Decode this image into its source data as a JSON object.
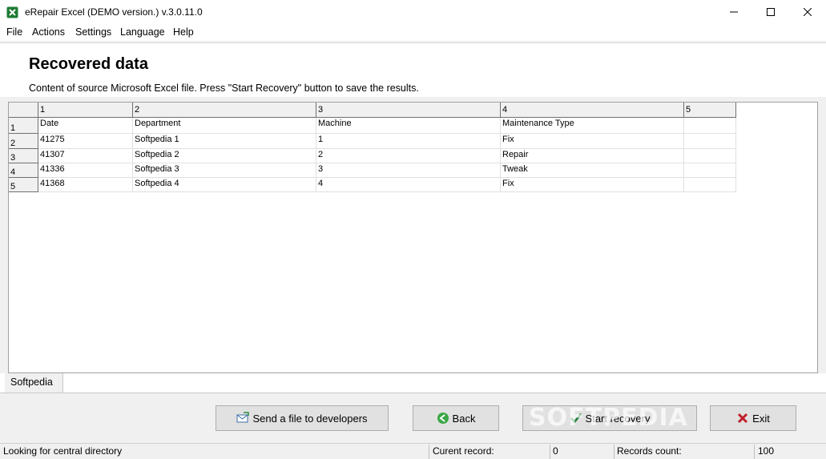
{
  "window": {
    "title": "eRepair Excel (DEMO version.) v.3.0.11.0"
  },
  "menu": [
    "File",
    "Actions",
    "Settings",
    "Language",
    "Help"
  ],
  "header": {
    "title": "Recovered data",
    "description": "Content of source Microsoft Excel file. Press \"Start Recovery\" button to save the results."
  },
  "grid": {
    "column_headers": [
      "1",
      "2",
      "3",
      "4",
      "5"
    ],
    "row_headers": [
      "1",
      "2",
      "3",
      "4",
      "5"
    ],
    "rows": [
      [
        "Date",
        "Department",
        "Machine",
        "Maintenance Type",
        ""
      ],
      [
        "41275",
        "Softpedia 1",
        "1",
        "Fix",
        ""
      ],
      [
        "41307",
        "Softpedia 2",
        "2",
        "Repair",
        ""
      ],
      [
        "41336",
        "Softpedia 3",
        "3",
        "Tweak",
        ""
      ],
      [
        "41368",
        "Softpedia 4",
        "4",
        "Fix",
        ""
      ]
    ]
  },
  "sheet_tab": "Softpedia",
  "buttons": {
    "send": "Send a file to developers",
    "back": "Back",
    "start": "Start recovery",
    "exit": "Exit"
  },
  "watermark": "SOFTPEDIA",
  "status": {
    "message": "Looking for central directory",
    "current_label": "Curent record:",
    "current_value": "0",
    "count_label": "Records count:",
    "count_value": "100"
  },
  "colors": {
    "accent_green": "#1e7b34",
    "exit_red": "#c0202a",
    "back_green": "#3aa845"
  }
}
